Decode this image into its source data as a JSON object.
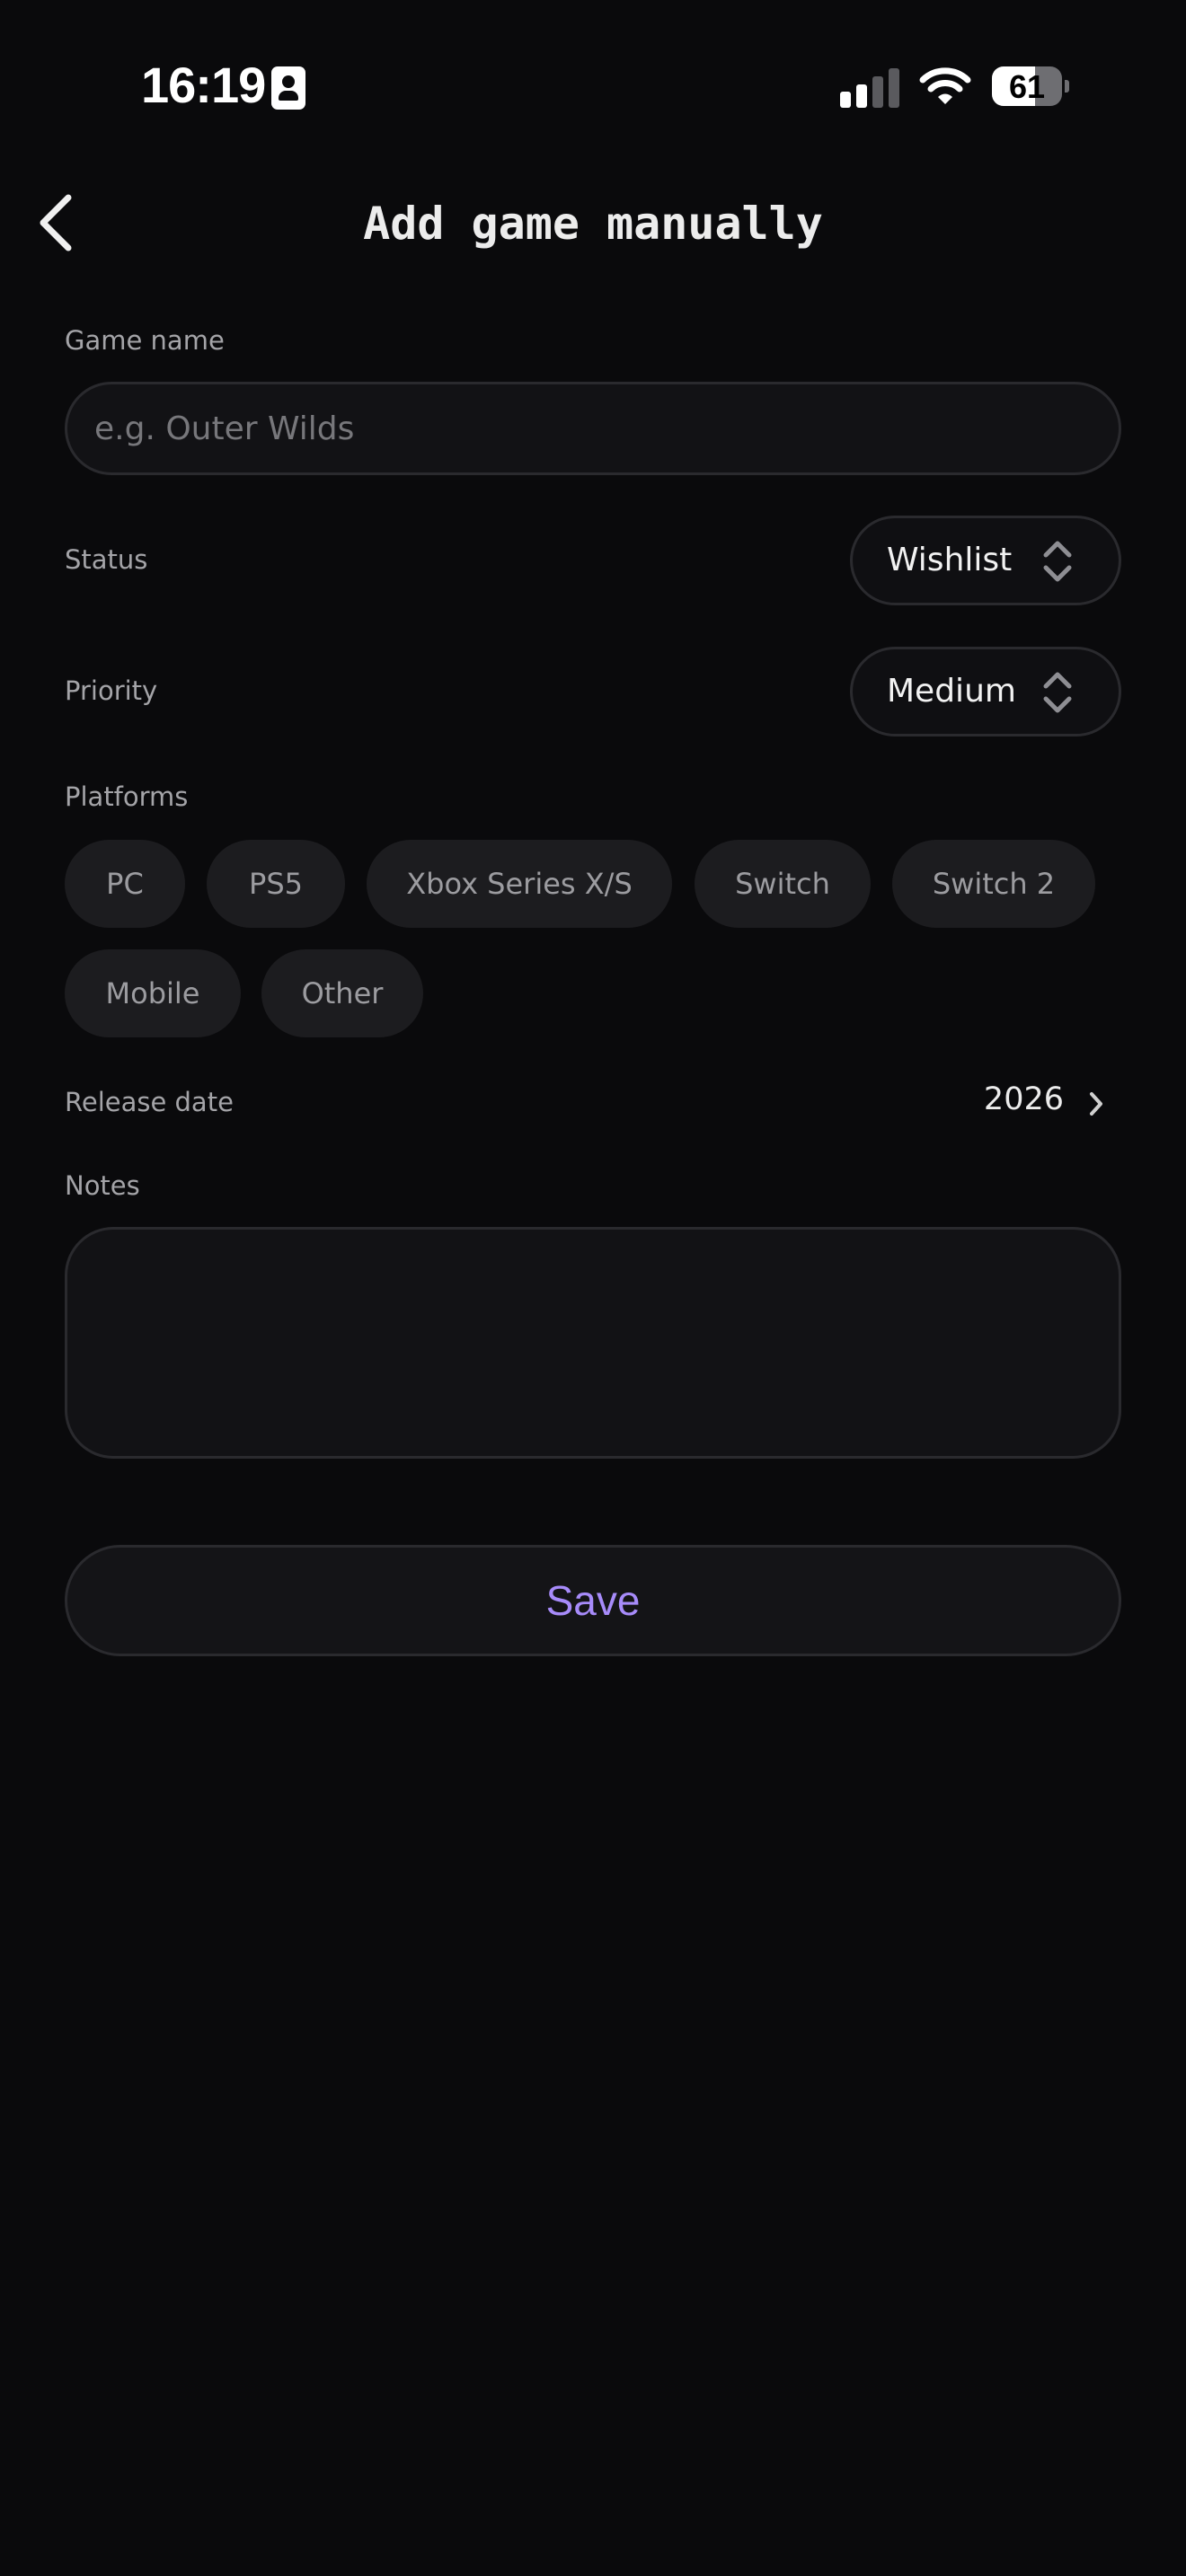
{
  "status_bar": {
    "time": "16:19",
    "battery_percent": "61",
    "battery_level": 0.61
  },
  "header": {
    "title": "Add game manually"
  },
  "form": {
    "game_name": {
      "label": "Game name",
      "placeholder": "e.g. Outer Wilds",
      "value": ""
    },
    "status": {
      "label": "Status",
      "value": "Wishlist"
    },
    "priority": {
      "label": "Priority",
      "value": "Medium"
    },
    "platforms": {
      "label": "Platforms",
      "options": [
        "PC",
        "PS5",
        "Xbox Series X/S",
        "Switch",
        "Switch 2",
        "Mobile",
        "Other"
      ]
    },
    "release_date": {
      "label": "Release date",
      "value": "2026"
    },
    "notes": {
      "label": "Notes",
      "value": ""
    },
    "save_label": "Save"
  },
  "colors": {
    "background": "#0a0a0c",
    "accent": "#a78bfa",
    "chip": "#1c1c1f",
    "border": "#2a2a2e"
  }
}
